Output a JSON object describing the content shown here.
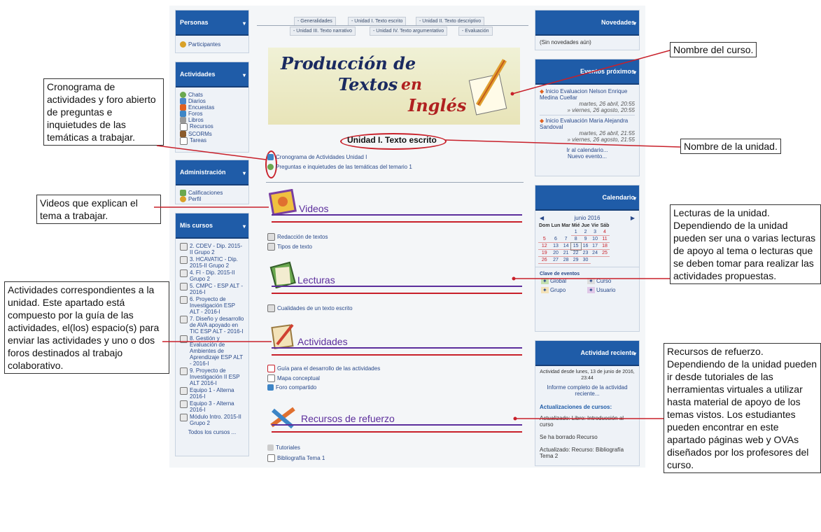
{
  "left_blocks": {
    "personas": {
      "title": "Personas",
      "items": [
        "Participantes"
      ]
    },
    "actividades": {
      "title": "Actividades",
      "items": [
        "Chats",
        "Diarios",
        "Encuestas",
        "Foros",
        "Libros",
        "Recursos",
        "SCORMs",
        "Tareas"
      ]
    },
    "administracion": {
      "title": "Administración",
      "items": [
        "Calificaciones",
        "Perfil"
      ]
    },
    "mis_cursos": {
      "title": "Mis cursos",
      "items": [
        "2. CDEV - Dip. 2015-II Grupo 2",
        "3. HCAVATIC - Dip. 2015-II Grupo 2",
        "4. FI - Dip. 2015-II Grupo 2",
        "5. CMPC - ESP ALT - 2016-I",
        "6. Proyecto de Investigación ESP ALT - 2016-I",
        "7. Diseño y desarrollo de AVA apoyado en TIC ESP ALT - 2016-I",
        "8. Gestión y Evaluación de Ambientes de Aprendizaje ESP ALT - 2016-I",
        "9. Proyecto de Investigación II ESP ALT 2016-I",
        "Equipo 1 - Alterna 2016-I",
        "Equipo 3 - Alterna 2016-I",
        "Módulo Intro. 2015-II Grupo 2"
      ],
      "all_label": "Todos los cursos ..."
    }
  },
  "tabs": {
    "row1": [
      "- Generalidades",
      "- Unidad I. Texto escrito",
      "- Unidad II. Texto descriptivo"
    ],
    "row2": [
      "- Unidad III. Texto narrativo",
      "- Unidad IV. Texto argumentativo",
      "- Evaluación"
    ]
  },
  "banner": {
    "line1": "Producción de",
    "line2a": "Textos",
    "line2b": "en",
    "line3": "Inglés"
  },
  "unit_title": "Unidad I. Texto escrito",
  "unit_links": [
    "Cronograma de Actividades Unidad I",
    "Preguntas e inquietudes de las temáticas del temario 1"
  ],
  "sections": {
    "videos": {
      "title": "Videos",
      "links": [
        "Redacción de textos",
        "Tipos de texto"
      ]
    },
    "lecturas": {
      "title": "Lecturas",
      "links": [
        "Cualidades de un texto escrito"
      ]
    },
    "actividades": {
      "title": "Actividades",
      "links": [
        "Guía para el desarrollo de las actividades",
        "Mapa conceptual",
        "Foro compartido"
      ]
    },
    "recursos": {
      "title": "Recursos de refuerzo",
      "links": [
        "Tutoriales",
        "Bibliografía Tema 1"
      ]
    }
  },
  "right_blocks": {
    "novedades": {
      "title": "Novedades",
      "body": "(Sin novedades aún)"
    },
    "eventos": {
      "title": "Eventos próximos",
      "events": [
        {
          "name": "Inicio Evaluacion Nelson Enrique Medina Cuellar",
          "start": "martes, 26 abril, 20:55",
          "end": "» viernes, 26 agosto, 20:55"
        },
        {
          "name": "Inicio Evaluación Maria Alejandra Sandoval",
          "start": "martes, 26 abril, 21:55",
          "end": "» viernes, 26 agosto, 21:55"
        }
      ],
      "calendar_link": "Ir al calendario...",
      "new_event": "Nuevo evento..."
    },
    "calendario": {
      "title": "Calendario",
      "month": "junio 2016",
      "weekdays": [
        "Dom",
        "Lun",
        "Mar",
        "Mié",
        "Jue",
        "Vie",
        "Sáb"
      ],
      "weeks": [
        [
          "",
          "",
          "",
          "1",
          "2",
          "3",
          "4"
        ],
        [
          "5",
          "6",
          "7",
          "8",
          "9",
          "10",
          "11"
        ],
        [
          "12",
          "13",
          "14",
          "15",
          "16",
          "17",
          "18"
        ],
        [
          "19",
          "20",
          "21",
          "22",
          "23",
          "24",
          "25"
        ],
        [
          "26",
          "27",
          "28",
          "29",
          "30",
          "",
          ""
        ]
      ],
      "key_title": "Clave de eventos",
      "keys": [
        "Global",
        "Curso",
        "Grupo",
        "Usuario"
      ]
    },
    "reciente": {
      "title": "Actividad reciente",
      "since": "Actividad desde lunes, 13 de junio de 2016, 23:44",
      "report": "Informe completo de la actividad reciente...",
      "updates_title": "Actualizaciones de cursos:",
      "updates": [
        "Actualizado: Libro: Introducción al curso",
        "Se ha borrado Recurso",
        "Actualizado: Recurso: Bibliografía Tema 2"
      ]
    }
  },
  "annotations": {
    "cronograma": "Cronograma de actividades y foro abierto de preguntas e inquietudes de las temáticas a trabajar.",
    "videos": "Videos que explican el tema a trabajar.",
    "actividades": "Actividades correspondientes a la unidad. Este apartado está compuesto por la guía de las actividades, el(los) espacio(s) para enviar las actividades y uno o dos foros destinados al trabajo colaborativo.",
    "nombre_curso": "Nombre del curso.",
    "nombre_unidad": "Nombre de la unidad.",
    "lecturas": "Lecturas de la unidad. Dependiendo de la unidad pueden ser una o varias lecturas de apoyo al tema o lecturas que se deben tomar para realizar las actividades propuestas.",
    "recursos": "Recursos de refuerzo. Dependiendo de la unidad pueden ir desde tutoriales de las herramientas virtuales a utilizar hasta material de apoyo de los temas vistos. Los estudiantes pueden encontrar en este apartado páginas web y OVAs diseñados por los profesores del curso."
  }
}
